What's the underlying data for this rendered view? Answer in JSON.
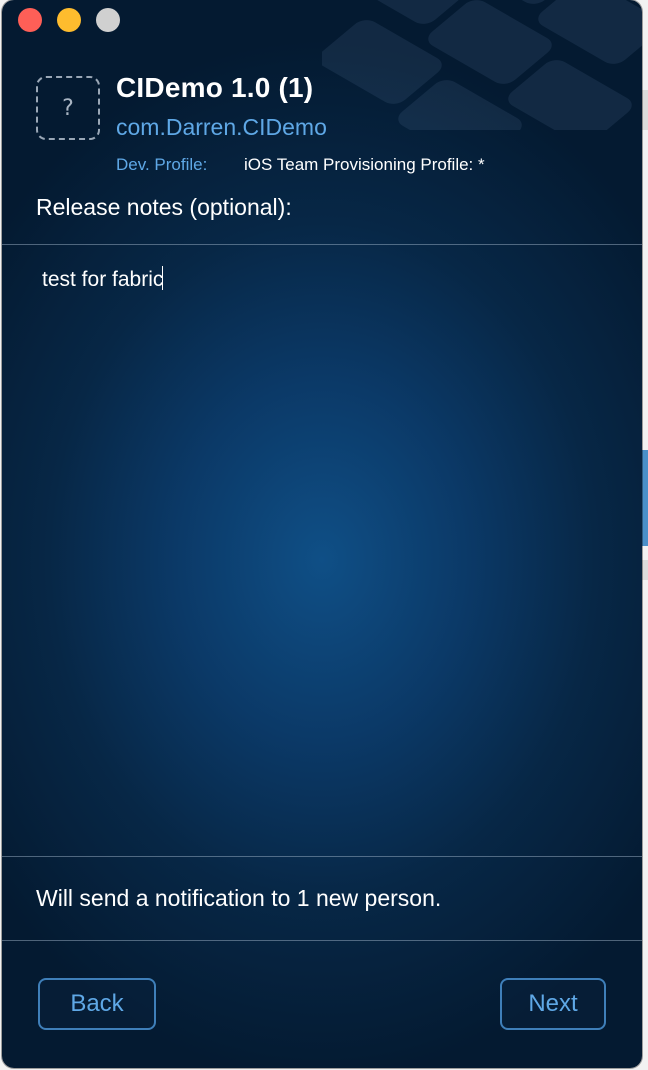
{
  "window": {
    "controls": [
      "close",
      "minimize",
      "zoom"
    ]
  },
  "app": {
    "icon": "placeholder-question-icon",
    "icon_glyph": "?",
    "title": "CIDemo 1.0 (1)",
    "bundle_id": "com.Darren.CIDemo",
    "profile_label": "Dev. Profile:",
    "profile_value": "iOS Team Provisioning Profile: *"
  },
  "release_notes": {
    "label": "Release notes (optional):",
    "value": "test for fabric"
  },
  "notification": {
    "text": "Will send a notification to 1 new person."
  },
  "buttons": {
    "back_label": "Back",
    "next_label": "Next"
  },
  "colors": {
    "accent": "#5fa8e6",
    "close": "#fe5f57",
    "minimize": "#febc2e",
    "zoom": "#d0d0d0"
  }
}
